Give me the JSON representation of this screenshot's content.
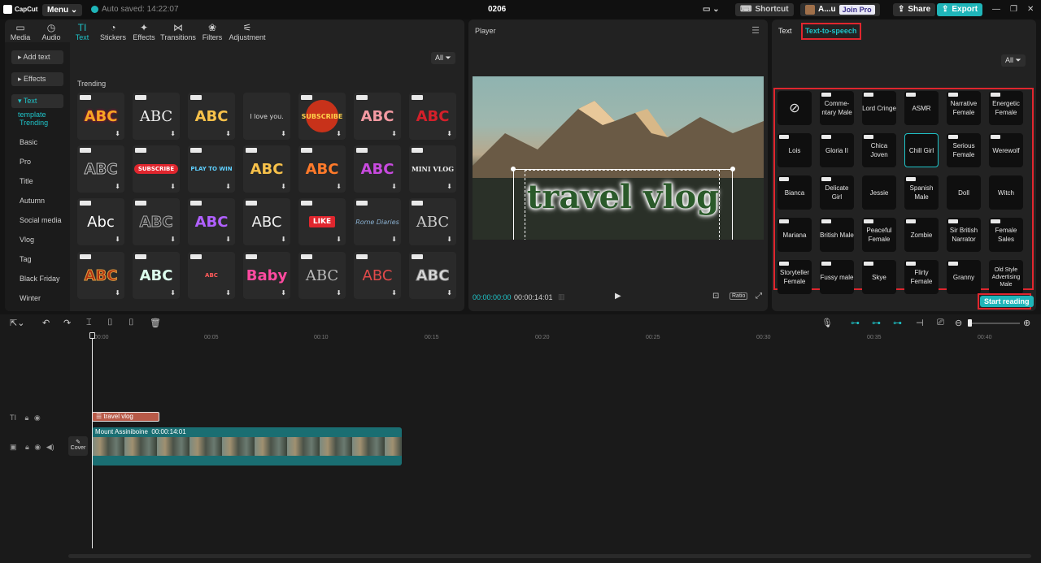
{
  "topbar": {
    "logo": "CapCut",
    "menu": "Menu",
    "autosave": "Auto saved: 14:22:07",
    "project_title": "0206",
    "shortcut": "Shortcut",
    "user": "A...u",
    "join_pro": "Join Pro",
    "share": "Share",
    "export": "Export"
  },
  "tabs": [
    {
      "label": "Media",
      "icon": "media-icon"
    },
    {
      "label": "Audio",
      "icon": "audio-icon"
    },
    {
      "label": "Text",
      "icon": "text-icon"
    },
    {
      "label": "Stickers",
      "icon": "stickers-icon"
    },
    {
      "label": "Effects",
      "icon": "effects-icon"
    },
    {
      "label": "Transitions",
      "icon": "transitions-icon"
    },
    {
      "label": "Filters",
      "icon": "filters-icon"
    },
    {
      "label": "Adjustment",
      "icon": "adjustment-icon"
    }
  ],
  "sidebar": {
    "add_text": "Add text",
    "effects": "Effects",
    "text_template": "Text template",
    "items": [
      "Trending",
      "Basic",
      "Pro",
      "Title",
      "Autumn",
      "Social media",
      "Vlog",
      "Tag",
      "Black Friday",
      "Winter"
    ]
  },
  "library": {
    "filter_label": "All",
    "section": "Trending",
    "cards": [
      "ABC",
      "ABC",
      "ABC",
      "I love you.",
      "SUBSCRIBE",
      "ABC",
      "ABC",
      "ABC",
      "SUBSCRIBE",
      "PLAY TO WIN",
      "ABC",
      "ABC",
      "ABC",
      "MINI VLOG",
      "Abc",
      "ABC",
      "ABC",
      "ABC",
      "LIKE",
      "Rome Diaries",
      "ABC",
      "ABC",
      "ABC",
      "ABC",
      "Baby",
      "ABC",
      "ABC",
      "ABC"
    ]
  },
  "player": {
    "title": "Player",
    "overlay_text": "travel vlog",
    "timecode_current": "00:00:00:00",
    "timecode_total": "00:00:14:01",
    "ratio": "Ratio"
  },
  "right_panel": {
    "tab_text": "Text",
    "tab_tts": "Text-to-speech",
    "filter_label": "All",
    "voices": [
      "",
      "Comme-ntary Male",
      "Lord Cringe",
      "ASMR",
      "Narrative Female",
      "Energetic Female",
      "Lois",
      "Gloria II",
      "Chica Joven",
      "Chill Girl",
      "Serious Female",
      "Werewolf",
      "Bianca",
      "Delicate Girl",
      "Jessie",
      "Spanish Male",
      "Doll",
      "Witch",
      "Mariana",
      "British Male",
      "Peaceful Female",
      "Zombie",
      "Sir British Narrator",
      "Female Sales",
      "Storyteller Female",
      "Fussy male",
      "Skye",
      "Flirty Female",
      "Granny",
      "Old Style Advertising Male"
    ],
    "start_reading": "Start reading"
  },
  "timeline": {
    "ruler": [
      "00:00",
      "00:05",
      "00:10",
      "00:15",
      "00:20",
      "00:25",
      "00:30",
      "00:35",
      "00:40"
    ],
    "text_clip": "travel vlog",
    "video_clip_name": "Mount Assiniboine",
    "video_clip_duration": "00:00:14:01",
    "cover": "Cover"
  },
  "colors": {
    "accent": "#1fc3c8",
    "highlight": "#e0262e"
  }
}
